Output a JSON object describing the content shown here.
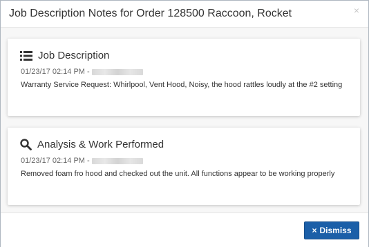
{
  "modal": {
    "title": "Job Description Notes for Order 128500 Raccoon, Rocket",
    "close_glyph": "×"
  },
  "notes": [
    {
      "icon": "list-icon",
      "heading": "Job Description",
      "timestamp": "01/23/17 02:14 PM -",
      "text": "Warranty Service Request: Whirlpool, Vent Hood, Noisy, the hood rattles loudly at the #2 setting"
    },
    {
      "icon": "search-icon",
      "heading": "Analysis & Work Performed",
      "timestamp": "01/23/17 02:14 PM -",
      "text": "Removed foam fro hood and checked out the unit. All functions appear to be working properly"
    }
  ],
  "footer": {
    "dismiss_icon": "×",
    "dismiss_label": "Dismiss"
  },
  "colors": {
    "primary_button": "#1b5fa8",
    "body_background": "#f7f7f7"
  }
}
